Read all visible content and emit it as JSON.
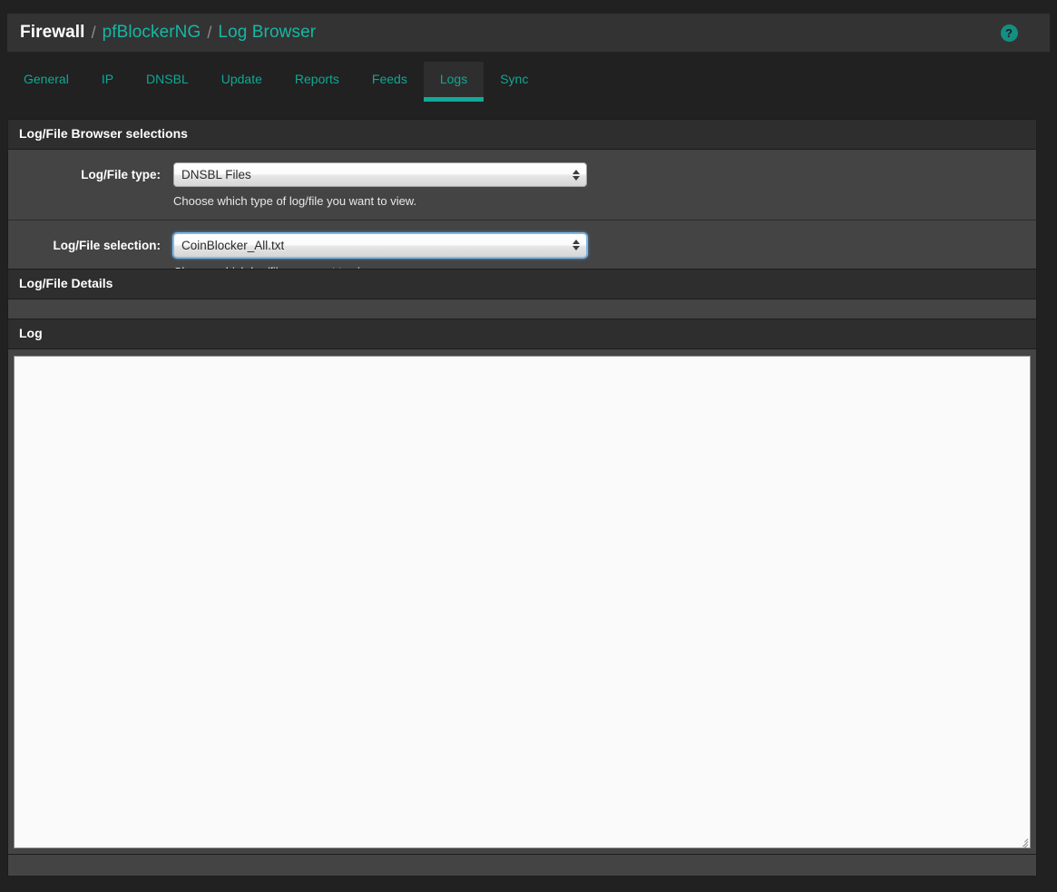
{
  "header": {
    "breadcrumb": [
      {
        "label": "Firewall",
        "root": true
      },
      {
        "label": "pfBlockerNG",
        "root": false
      },
      {
        "label": "Log Browser",
        "root": false
      }
    ],
    "separator": "/",
    "help_icon": "help-circle-icon",
    "help_glyph": "?",
    "accent_color": "#15b7a4"
  },
  "tabs": [
    {
      "label": "General",
      "active": false
    },
    {
      "label": "IP",
      "active": false
    },
    {
      "label": "DNSBL",
      "active": false
    },
    {
      "label": "Update",
      "active": false
    },
    {
      "label": "Reports",
      "active": false
    },
    {
      "label": "Feeds",
      "active": false
    },
    {
      "label": "Logs",
      "active": true
    },
    {
      "label": "Sync",
      "active": false
    }
  ],
  "selections_panel": {
    "title": "Log/File Browser selections",
    "rows": [
      {
        "label": "Log/File type:",
        "value": "DNSBL Files",
        "help": "Choose which type of log/file you want to view.",
        "focused": false
      },
      {
        "label": "Log/File selection:",
        "value": "CoinBlocker_All.txt",
        "help": "Choose which log/file you want to view.",
        "focused": true
      }
    ]
  },
  "details_panel": {
    "title": "Log/File Details",
    "body_text": ""
  },
  "log_panel": {
    "title": "Log",
    "textarea_value": "",
    "resize_grip": "resize-grip-icon"
  }
}
